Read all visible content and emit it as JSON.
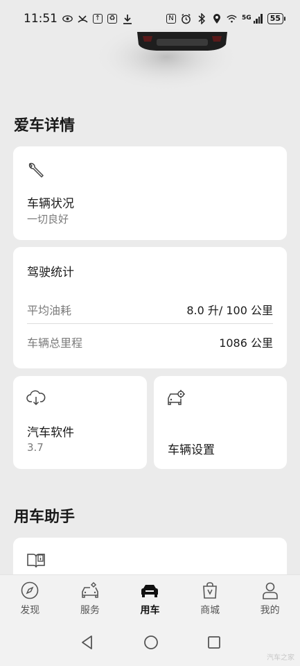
{
  "status_bar": {
    "time": "11:51",
    "network": "5G",
    "battery": "55"
  },
  "details": {
    "title": "爱车详情",
    "vehicle_status": {
      "title": "车辆状况",
      "status": "一切良好"
    },
    "driving_stats": {
      "title": "驾驶统计",
      "rows": [
        {
          "label": "平均油耗",
          "value": "8.0 升/ 100 公里"
        },
        {
          "label": "车辆总里程",
          "value": "1086 公里"
        }
      ]
    },
    "software": {
      "title": "汽车软件",
      "version": "3.7"
    },
    "settings": {
      "title": "车辆设置"
    }
  },
  "assistant": {
    "title": "用车助手"
  },
  "bottom_nav": {
    "items": [
      {
        "label": "发现",
        "icon": "compass-icon"
      },
      {
        "label": "服务",
        "icon": "car-service-icon"
      },
      {
        "label": "用车",
        "icon": "car-icon",
        "active": true
      },
      {
        "label": "商城",
        "icon": "shopping-bag-icon"
      },
      {
        "label": "我的",
        "icon": "person-icon"
      }
    ]
  },
  "watermark": "汽车之家",
  "colors": {
    "background": "#ebebeb",
    "card": "#ffffff",
    "text": "#1a1a1a",
    "secondary": "#7a7a7a"
  }
}
